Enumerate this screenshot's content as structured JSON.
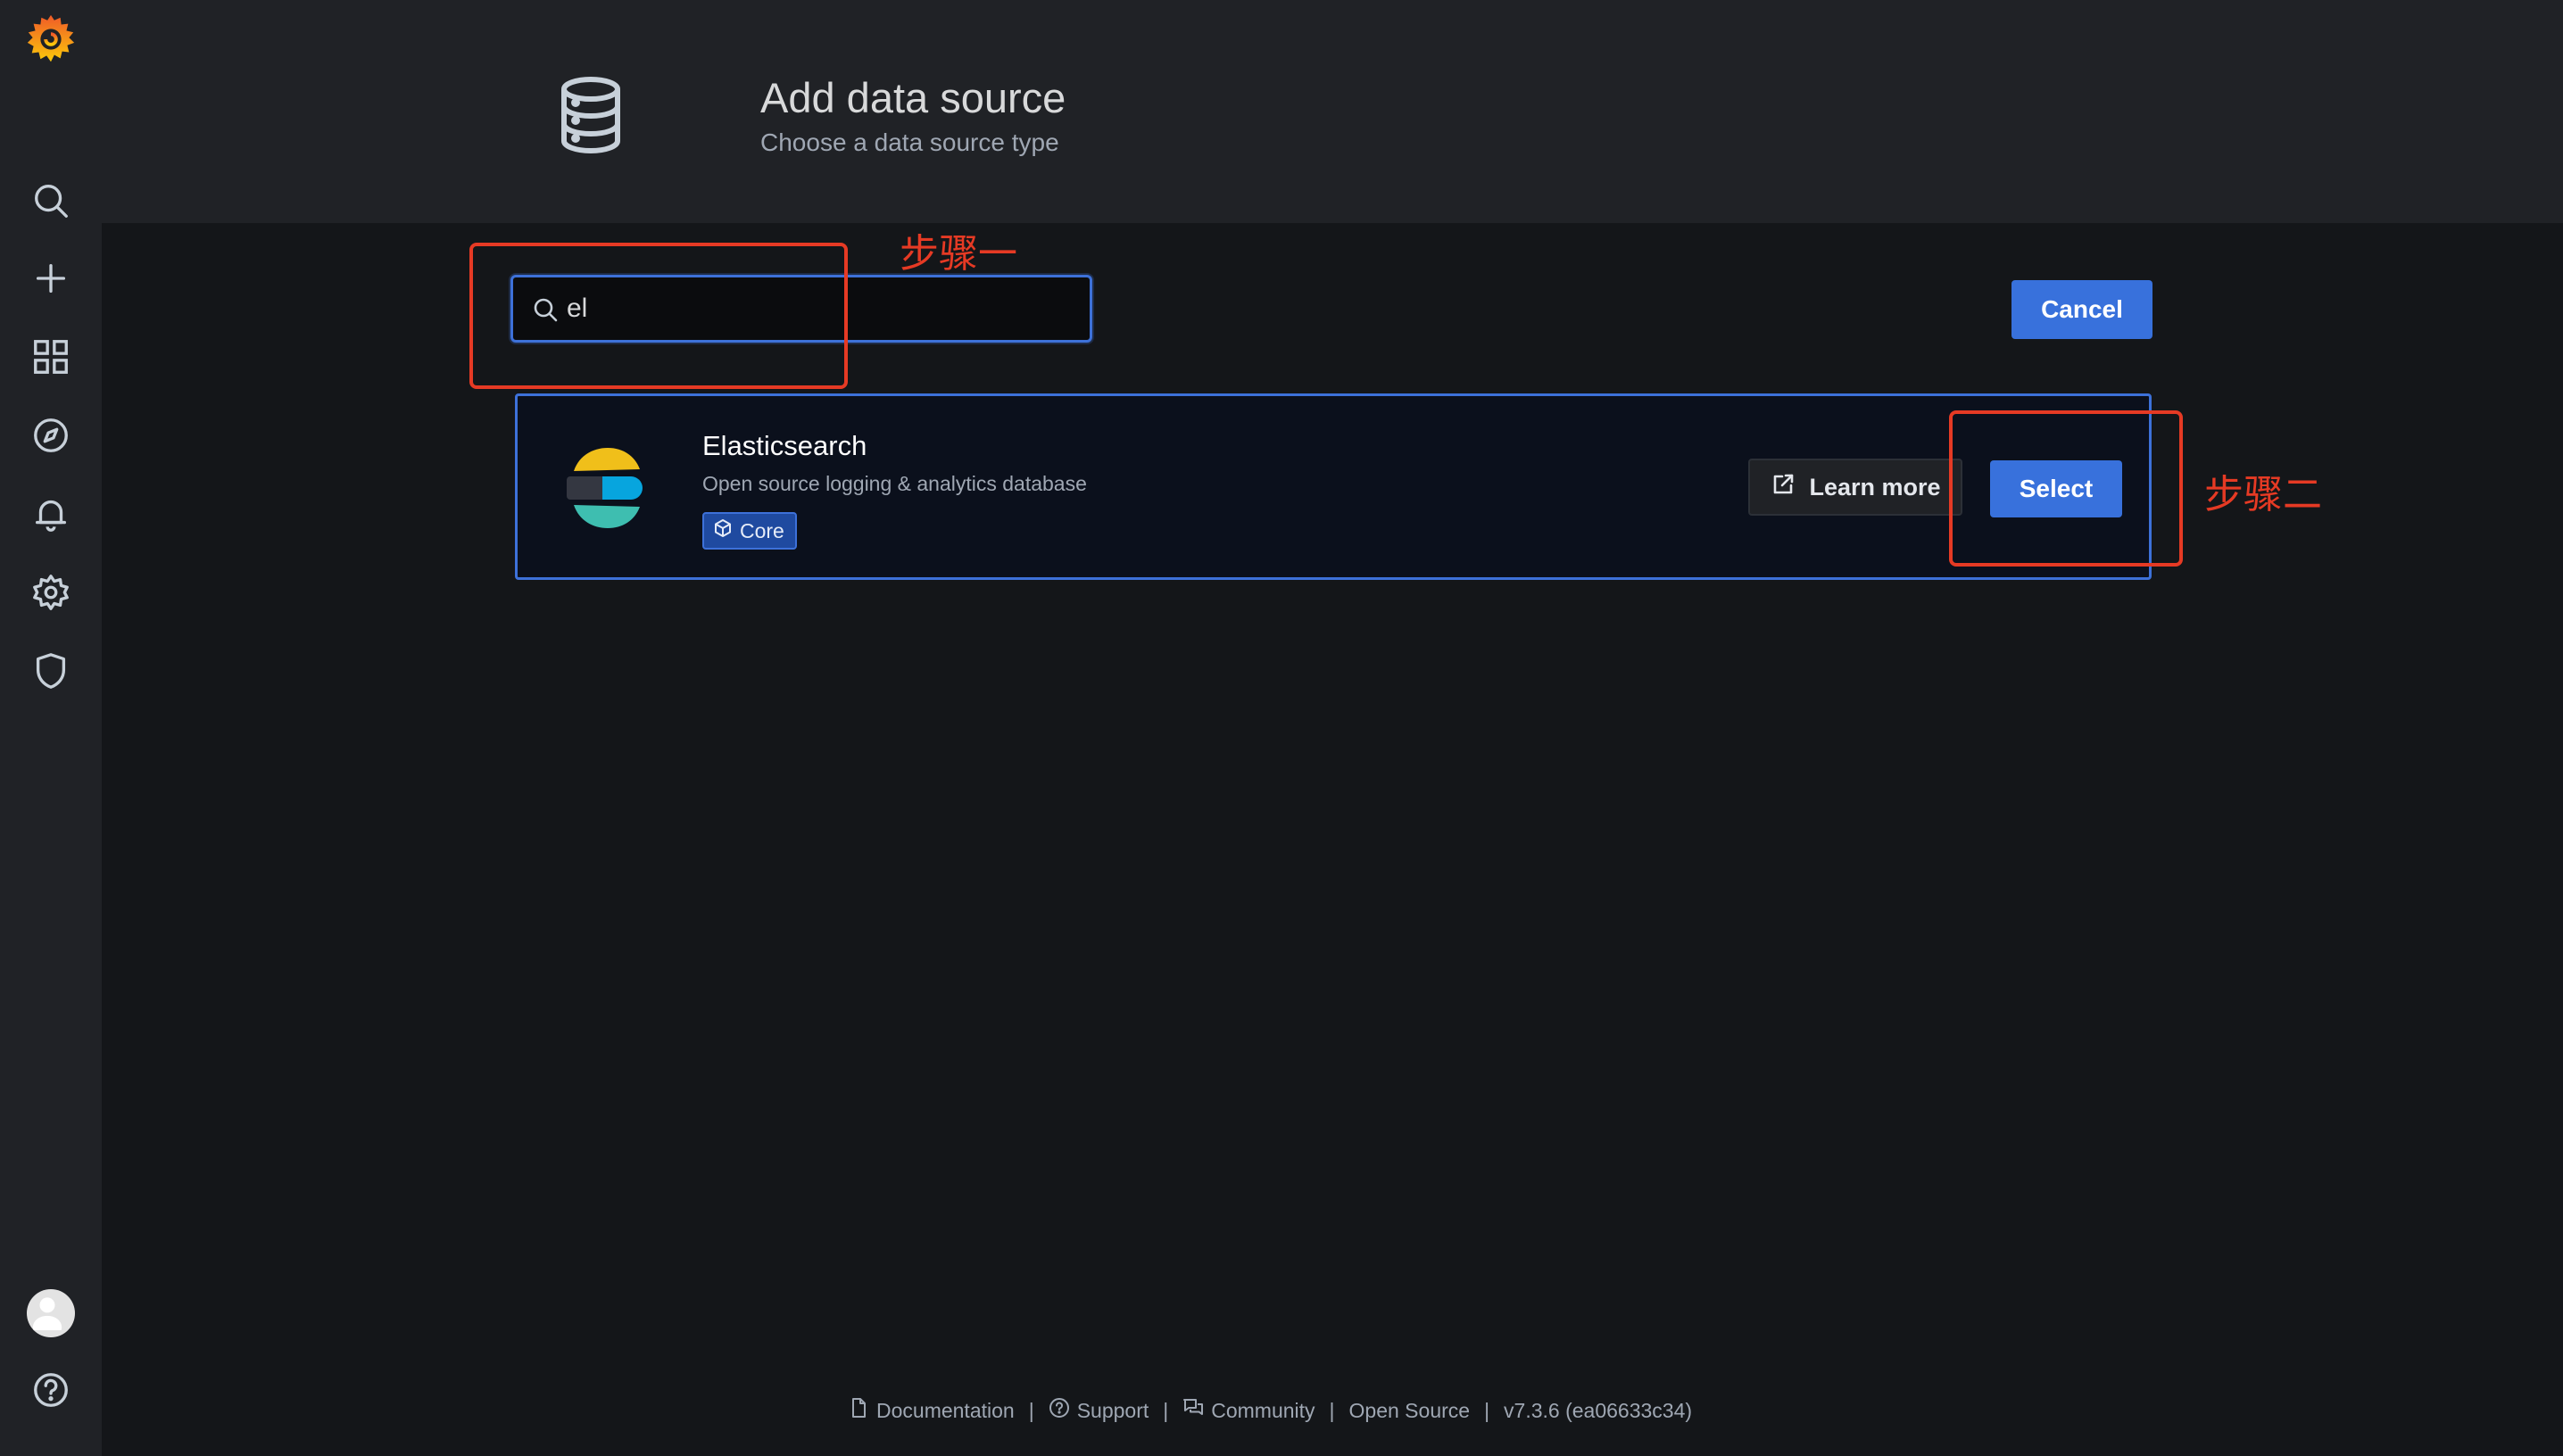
{
  "header": {
    "title": "Add data source",
    "subtitle": "Choose a data source type"
  },
  "search": {
    "value": "el"
  },
  "actions": {
    "cancel_label": "Cancel"
  },
  "results": [
    {
      "name": "Elasticsearch",
      "description": "Open source logging & analytics database",
      "badge": "Core",
      "learn_more_label": "Learn more",
      "select_label": "Select"
    }
  ],
  "annotations": {
    "step1": "步骤一",
    "step2": "步骤二"
  },
  "footer": {
    "links": [
      {
        "label": "Documentation",
        "icon": "document-icon"
      },
      {
        "label": "Support",
        "icon": "question-circle-icon"
      },
      {
        "label": "Community",
        "icon": "comments-icon"
      },
      {
        "label": "Open Source",
        "icon": ""
      },
      {
        "label": "v7.3.6 (ea06633c34)",
        "icon": ""
      }
    ]
  },
  "sidebar": {
    "items": [
      {
        "name": "grafana-logo",
        "icon": "grafana-logo-icon"
      },
      {
        "name": "search",
        "icon": "search-icon"
      },
      {
        "name": "create",
        "icon": "plus-icon"
      },
      {
        "name": "dashboards",
        "icon": "apps-icon"
      },
      {
        "name": "explore",
        "icon": "compass-icon"
      },
      {
        "name": "alerting",
        "icon": "bell-icon"
      },
      {
        "name": "configuration",
        "icon": "gear-icon"
      },
      {
        "name": "server-admin",
        "icon": "shield-icon"
      },
      {
        "name": "profile",
        "icon": "avatar"
      },
      {
        "name": "help",
        "icon": "question-circle-icon"
      }
    ]
  },
  "colors": {
    "primary": "#3871dc",
    "background": "#141619",
    "panel": "#202226",
    "annotation": "#e63a24",
    "grafana_orange": "#f05a28",
    "grafana_yellow": "#fbca0a"
  }
}
